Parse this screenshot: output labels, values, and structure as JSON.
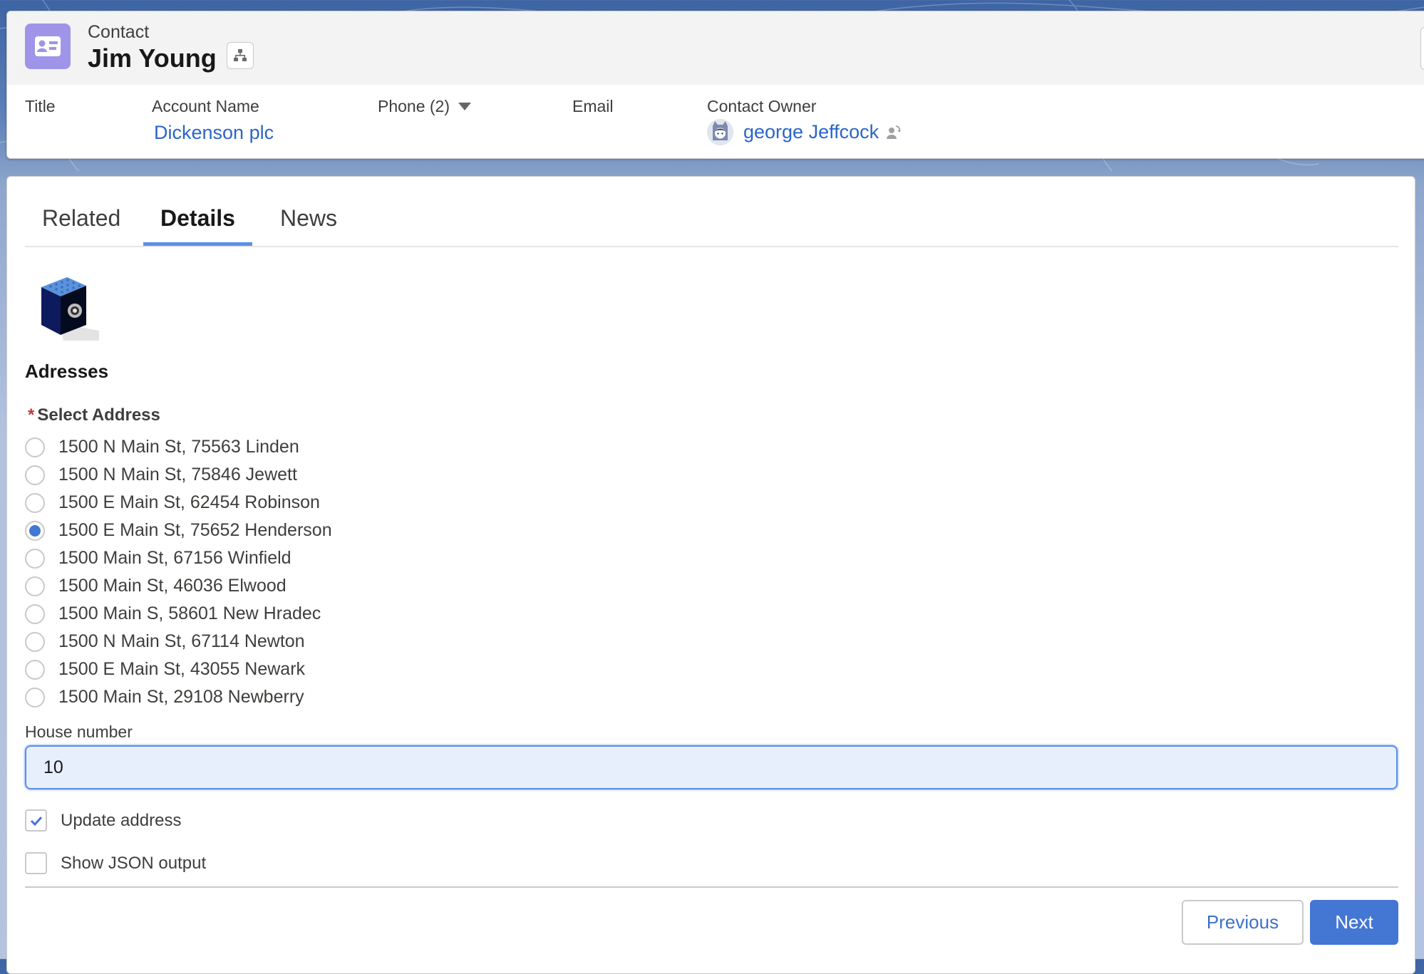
{
  "header": {
    "object_type": "Contact",
    "record_name": "Jim Young",
    "icons": {
      "object": "contact-card-icon",
      "hierarchy": "hierarchy-icon"
    },
    "fields": [
      {
        "label": "Title",
        "value": ""
      },
      {
        "label": "Account Name",
        "value": "Dickenson plc"
      },
      {
        "label": "Phone (2)",
        "value": ""
      },
      {
        "label": "Email",
        "value": ""
      },
      {
        "label": "Contact Owner",
        "value": "george Jeffcock"
      }
    ]
  },
  "tabs": [
    {
      "label": "Related",
      "active": false
    },
    {
      "label": "Details",
      "active": true
    },
    {
      "label": "News",
      "active": false
    }
  ],
  "form": {
    "section_title": "Adresses",
    "select_label": "Select Address",
    "required_marker": "*",
    "addresses": [
      {
        "label": "1500 N Main St, 75563 Linden",
        "selected": false
      },
      {
        "label": "1500 N Main St, 75846 Jewett",
        "selected": false
      },
      {
        "label": "1500 E Main St, 62454 Robinson",
        "selected": false
      },
      {
        "label": "1500 E Main St, 75652 Henderson",
        "selected": true
      },
      {
        "label": "1500 Main St, 67156 Winfield",
        "selected": false
      },
      {
        "label": "1500 Main St, 46036 Elwood",
        "selected": false
      },
      {
        "label": "1500 Main S, 58601 New Hradec",
        "selected": false
      },
      {
        "label": "1500 N Main St, 67114 Newton",
        "selected": false
      },
      {
        "label": "1500 E Main St, 43055 Newark",
        "selected": false
      },
      {
        "label": "1500 Main St, 29108 Newberry",
        "selected": false
      }
    ],
    "house_number_label": "House number",
    "house_number_value": "10",
    "update_address": {
      "label": "Update address",
      "checked": true
    },
    "show_json": {
      "label": "Show JSON output",
      "checked": false
    }
  },
  "buttons": {
    "previous": "Previous",
    "next": "Next"
  },
  "colors": {
    "brand": "#4476d4",
    "link": "#2b65c7",
    "contact_icon_bg": "#9e95e8",
    "required": "#c23934"
  }
}
